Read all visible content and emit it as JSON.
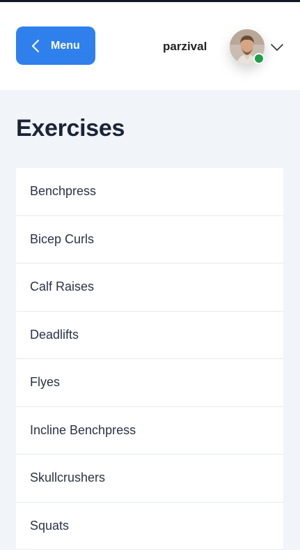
{
  "header": {
    "menu_label": "Menu",
    "username": "parzival",
    "status_color": "#1e9e4a",
    "accent_color": "#2f80ed"
  },
  "main": {
    "title": "Exercises",
    "exercises": [
      "Benchpress",
      "Bicep Curls",
      "Calf Raises",
      "Deadlifts",
      "Flyes",
      "Incline Benchpress",
      "Skullcrushers",
      "Squats"
    ]
  },
  "icons": {
    "menu_button": "chevron-left-icon",
    "user_dropdown": "chevron-down-icon"
  }
}
